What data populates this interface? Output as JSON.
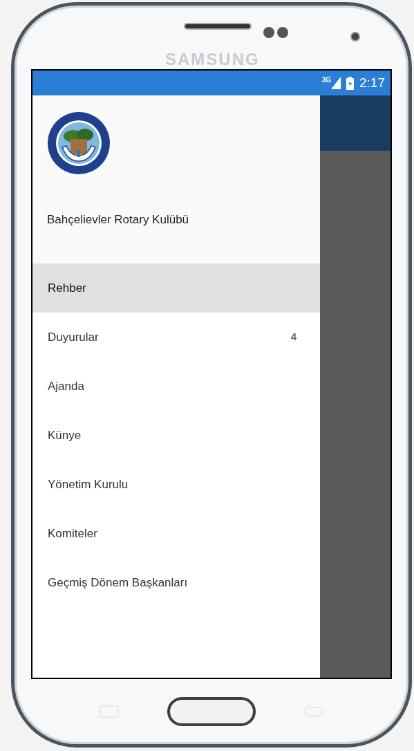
{
  "device": {
    "brand": "SAMSUNG"
  },
  "status_bar": {
    "network": "3G",
    "time": "2:17"
  },
  "drawer": {
    "title": "Bahçelievler Rotary Kulübü",
    "items": [
      {
        "label": "Rehber",
        "selected": true
      },
      {
        "label": "Duyurular",
        "selected": false,
        "count": "4"
      },
      {
        "label": "Ajanda",
        "selected": false
      },
      {
        "label": "Künye",
        "selected": false
      },
      {
        "label": "Yönetim Kurulu",
        "selected": false
      },
      {
        "label": "Komiteler",
        "selected": false
      },
      {
        "label": "Geçmiş Dönem Başkanları",
        "selected": false
      }
    ]
  }
}
